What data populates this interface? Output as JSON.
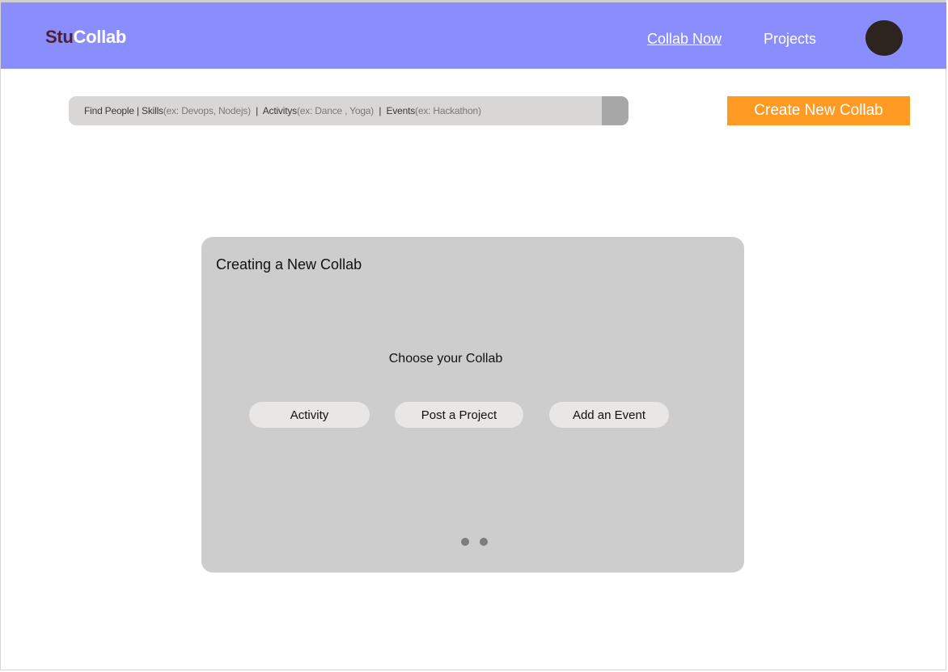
{
  "header": {
    "logo_part1": "Stu",
    "logo_part2": "Collab",
    "nav": {
      "collab_now": "Collab Now",
      "projects": "Projects"
    }
  },
  "search": {
    "segments": [
      {
        "label": "Find People",
        "hint": ""
      },
      {
        "label": "Skills",
        "hint": "(ex: Devops, Nodejs)"
      },
      {
        "label": "Activitys",
        "hint": "(ex: Dance , Yoga)"
      },
      {
        "label": "Events",
        "hint": "(ex: Hackathon)"
      }
    ]
  },
  "create_button": "Create New Collab",
  "modal": {
    "title": "Creating a New Collab",
    "subtitle": "Choose your Collab",
    "choices": {
      "activity": "Activity",
      "project": "Post a Project",
      "event": "Add an Event"
    },
    "pager_dots": 2
  },
  "colors": {
    "header_bg": "#8a8dfd",
    "accent_orange": "#ff9a24",
    "logo_dark": "#4a2236",
    "modal_bg": "#cdcdcd"
  }
}
